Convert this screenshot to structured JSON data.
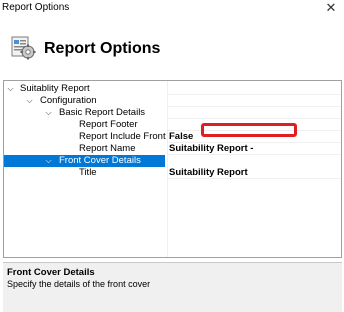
{
  "window": {
    "title": "Report Options",
    "close_glyph": "✕"
  },
  "header": {
    "icon": "report-gear-icon",
    "heading": "Report Options"
  },
  "tree": {
    "rows": [
      {
        "label": "Suitablity Report",
        "value": "",
        "expander": "⌵"
      },
      {
        "label": "Configuration",
        "value": "",
        "expander": "⌵"
      },
      {
        "label": "Basic Report Details",
        "value": "",
        "expander": "⌵"
      },
      {
        "label": "Report Footer",
        "value": ""
      },
      {
        "label": "Report Include Front",
        "value": "False"
      },
      {
        "label": "Report Name",
        "value": "Suitability Report -"
      },
      {
        "label": "Front Cover Details",
        "value": "",
        "expander": "⌵",
        "selected": true
      },
      {
        "label": "Title",
        "value": "Suitability Report"
      }
    ]
  },
  "description": {
    "title": "Front Cover Details",
    "text": "Specify the details of the front cover"
  },
  "colors": {
    "selection": "#0078d7",
    "highlight": "#e02020"
  }
}
